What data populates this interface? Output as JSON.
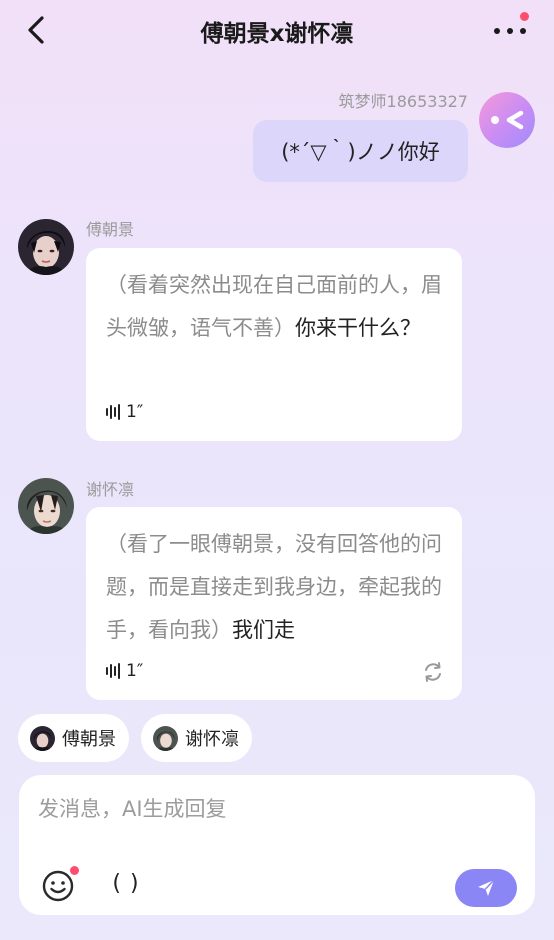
{
  "header": {
    "title": "傅朝景x谢怀凛",
    "back_icon": "chevron-left-icon",
    "more_icon": "more-dots-icon",
    "badge_color": "#ff4d6d"
  },
  "messages": [
    {
      "sender": "筑梦师18653327",
      "text": "(*´▽｀)ノノ你好"
    },
    {
      "sender": "傅朝景",
      "narration": "（看着突然出现在自己面前的人，眉头微皱，语气不善）",
      "speech": "你来干什么？",
      "voice_duration": "1″"
    },
    {
      "sender": "谢怀凛",
      "narration": "（看了一眼傅朝景，没有回答他的问题，而是直接走到我身边，牵起我的手，看向我）",
      "speech": "我们走",
      "voice_duration": "1″"
    }
  ],
  "chips": [
    {
      "label": "傅朝景"
    },
    {
      "label": "谢怀凛"
    }
  ],
  "composer": {
    "placeholder": "发消息，AI生成回复",
    "paren_label": "( )"
  },
  "colors": {
    "accent": "#8b86f6",
    "user_bubble": "#dcd6fb"
  }
}
